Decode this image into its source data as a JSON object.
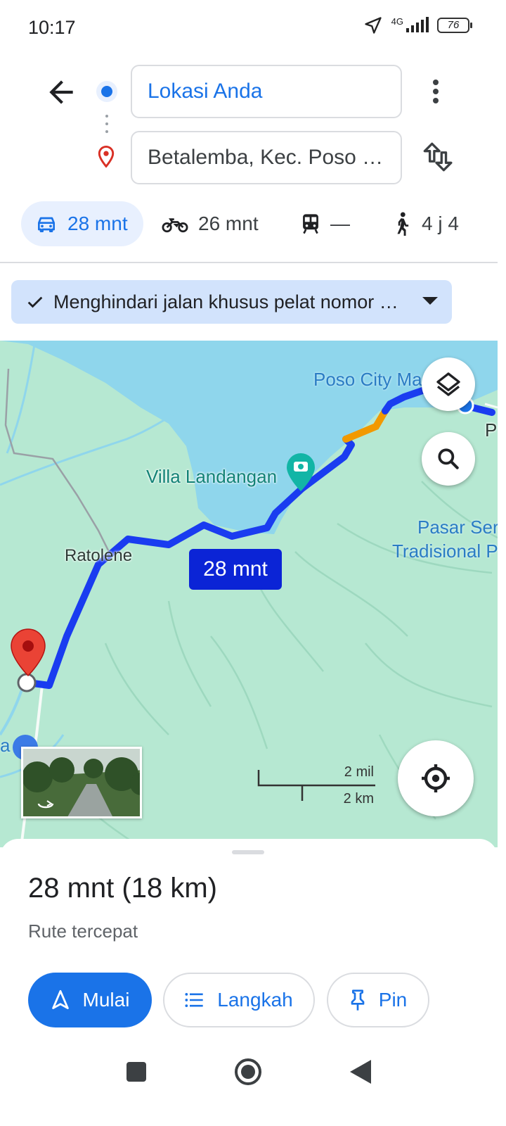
{
  "status_bar": {
    "time": "10:17",
    "network": "4G",
    "battery": "76"
  },
  "directions": {
    "origin": "Lokasi Anda",
    "destination": "Betalemba, Kec. Poso Pesisir, Kabupaten Poso, Sulawesi Tengah"
  },
  "modes": [
    {
      "name": "car",
      "label": "28 mnt",
      "active": true
    },
    {
      "name": "motorcycle",
      "label": "26 mnt"
    },
    {
      "name": "transit",
      "label": "—"
    },
    {
      "name": "walk",
      "label": "4 j 4"
    }
  ],
  "route_option": {
    "label": "Menghindari jalan khusus pelat nomor ganjil/genap"
  },
  "map": {
    "labels": {
      "poso_city": "Poso City Ma",
      "villa": "Villa Landangan",
      "ratolene": "Ratolene",
      "pasar_line1": "Pasar Ser",
      "pasar_line2": "Tradisional P",
      "edge_p": "P",
      "edge_a": "a"
    },
    "route_duration": "28 mnt",
    "scale": {
      "imperial": "2 mil",
      "metric": "2 km"
    },
    "colors": {
      "route": "#1a3cf0",
      "traffic": "#f29900",
      "water": "#8fd6ec",
      "land": "#b6e8d2"
    }
  },
  "sheet": {
    "summary": "28 mnt (18 km)",
    "subtitle": "Rute tercepat",
    "buttons": {
      "start": "Mulai",
      "steps": "Langkah",
      "pin": "Pin"
    }
  }
}
